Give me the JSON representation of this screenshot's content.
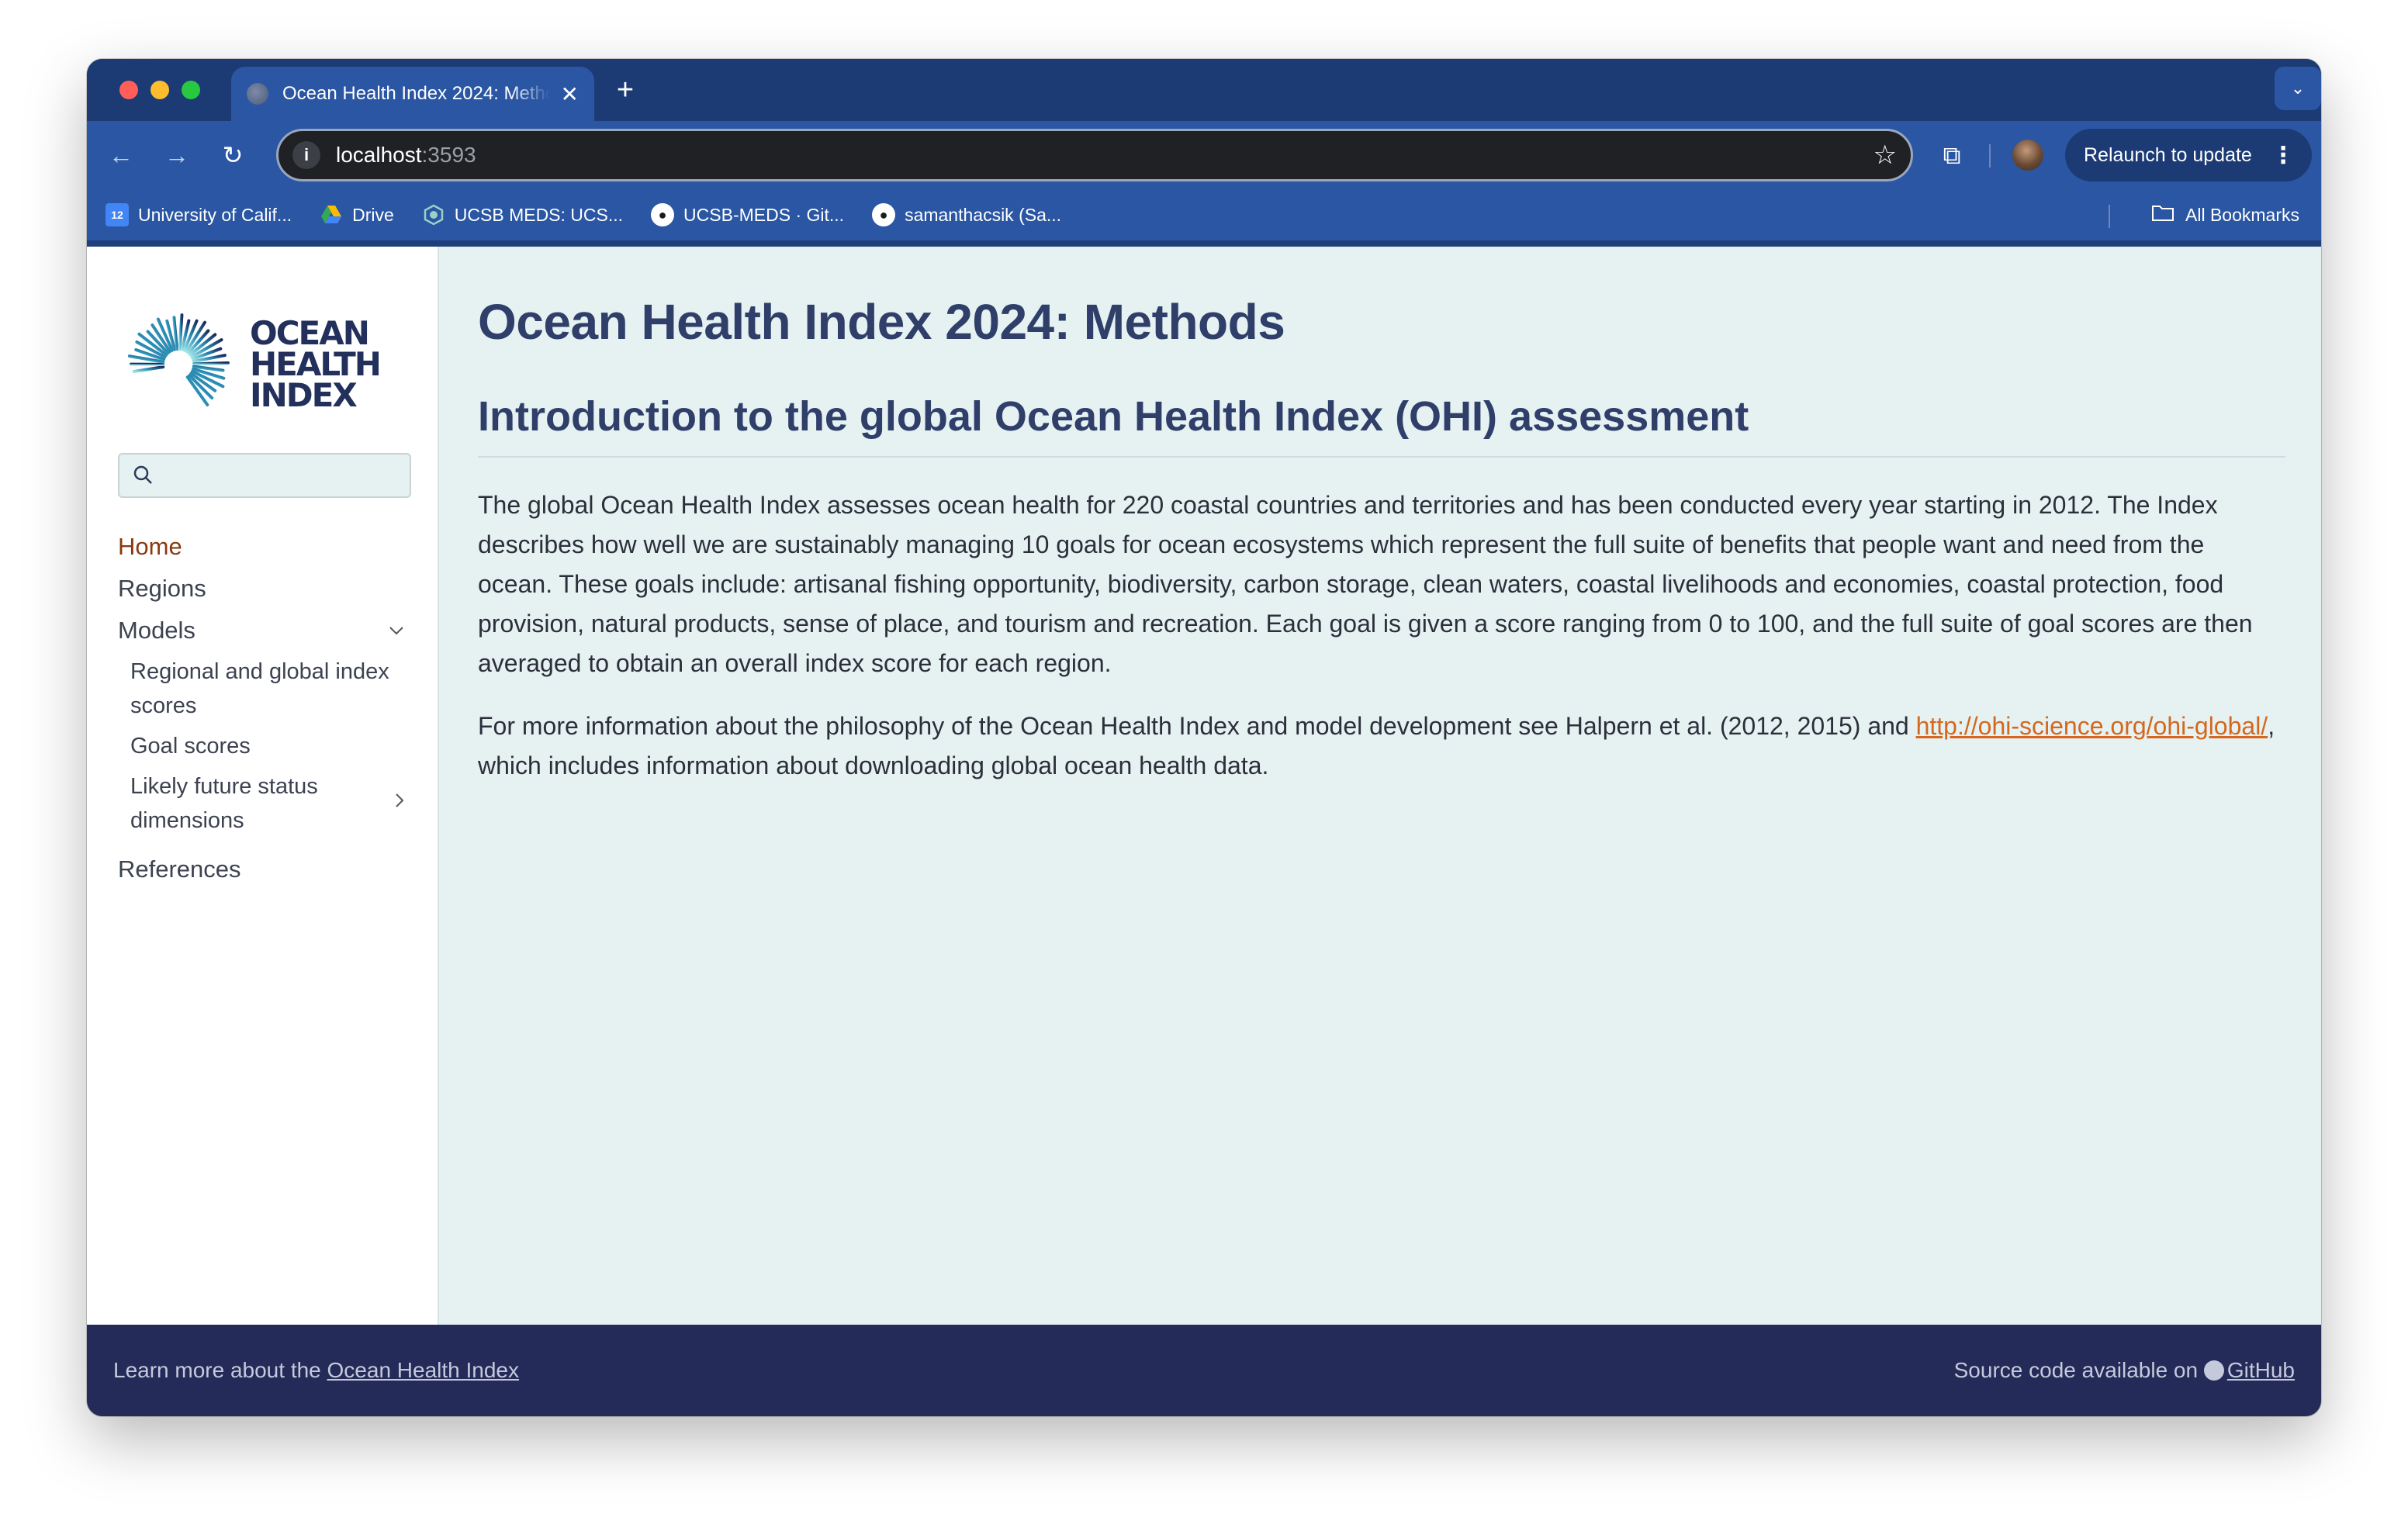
{
  "browser": {
    "tab_title": "Ocean Health Index 2024: Methods",
    "tab_close": "✕",
    "new_tab": "+",
    "url_host": "localhost",
    "url_port": ":3593",
    "relaunch_label": "Relaunch to update",
    "bookmarks": [
      {
        "label": "University of Calif...",
        "icon": "calendar-icon"
      },
      {
        "label": "Drive",
        "icon": "drive-icon"
      },
      {
        "label": "UCSB MEDS: UCS...",
        "icon": "ucsb-icon"
      },
      {
        "label": "UCSB-MEDS · Git...",
        "icon": "github-icon"
      },
      {
        "label": "samanthacsik (Sa...",
        "icon": "github-icon"
      }
    ],
    "all_bookmarks": "All Bookmarks"
  },
  "sidebar": {
    "logo_lines": [
      "OCEAN",
      "HEALTH",
      "INDEX"
    ],
    "search_placeholder": "",
    "items": {
      "home": "Home",
      "regions": "Regions",
      "models": "Models",
      "models_sub": {
        "regional": "Regional and global index scores",
        "goal": "Goal scores",
        "likely": "Likely future status dimensions"
      },
      "references": "References"
    }
  },
  "main": {
    "title": "Ocean Health Index 2024: Methods",
    "section_title": "Introduction to the global Ocean Health Index (OHI) assessment",
    "para1": "The global Ocean Health Index assesses ocean health for 220 coastal countries and territories and has been conducted every year starting in 2012. The Index describes how well we are sustainably managing 10 goals for ocean ecosystems which represent the full suite of benefits that people want and need from the ocean. These goals include: artisanal fishing opportunity, biodiversity, carbon storage, clean waters, coastal livelihoods and economies, coastal protection, food provision, natural products, sense of place, and tourism and recreation. Each goal is given a score ranging from 0 to 100, and the full suite of goal scores are then averaged to obtain an overall index score for each region.",
    "para2_before": "For more information about the philosophy of the Ocean Health Index and model development see Halpern et al. (2012, 2015) and ",
    "para2_link": "http://ohi-science.org/ohi-global/",
    "para2_after": ", which includes information about downloading global ocean health data."
  },
  "footer": {
    "left_text": "Learn more about the ",
    "left_link": "Ocean Health Index",
    "right_text": "Source code available on ",
    "right_link": "GitHub"
  }
}
